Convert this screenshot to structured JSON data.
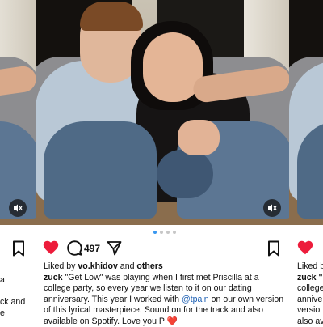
{
  "post": {
    "likes": {
      "prefix": "Liked by ",
      "user": "vo.khidov",
      "middle": " and ",
      "others": "others"
    },
    "comment_count": "497",
    "caption": {
      "username": "zuck",
      "text_part1": " \"Get Low\" was playing when I first met Priscilla at a college party, so every year we listen to it on our dating anniversary. This year I worked with ",
      "mention": "@tpain",
      "text_part2": " on our own version of this lyrical masterpiece. Sound on for the track and also available on Spotify. Love you P ",
      "emoji": "❤️"
    },
    "carousel": {
      "current": 1,
      "total": 4
    }
  },
  "left_neighbor": {
    "lines": [
      "a",
      "",
      "ck and",
      "e"
    ]
  },
  "right_neighbor": {
    "lines": [
      "Liked b",
      "zuck \"",
      "college",
      "annive",
      "versio",
      "also av"
    ]
  },
  "icons": {
    "like": "heart-icon",
    "comment": "comment-icon",
    "share": "send-icon",
    "save": "bookmark-icon",
    "mute": "speaker-muted-icon"
  },
  "colors": {
    "like_red": "#ed1c3b",
    "link_blue": "#1c5fb3",
    "dot_active": "#3897f0"
  }
}
